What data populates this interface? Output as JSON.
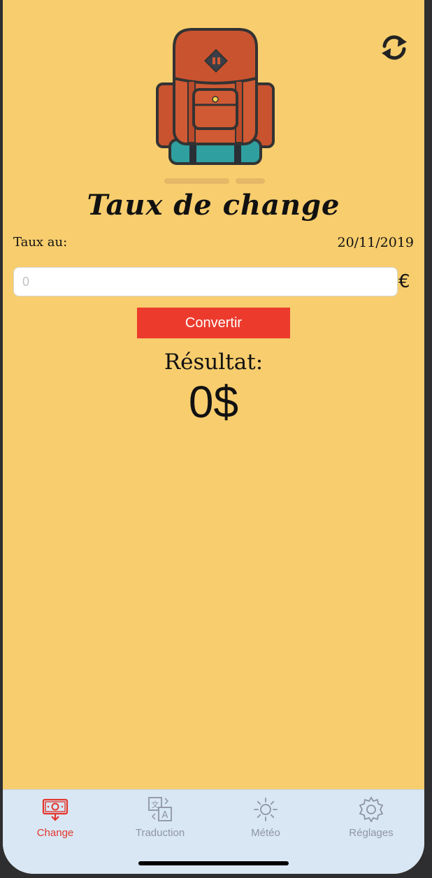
{
  "header": {
    "refresh_icon": "refresh-icon",
    "backpack_icon": "backpack-icon",
    "page_indicator": {
      "pages": 2,
      "current": 1
    }
  },
  "main": {
    "title": "Taux de change",
    "rate_label": "Taux au:",
    "rate_date": "20/11/2019",
    "amount_placeholder": "0",
    "amount_value": "",
    "currency_symbol": "€",
    "convert_label": "Convertir",
    "result_label": "Résultat:",
    "result_value": "0$"
  },
  "tabbar": {
    "items": [
      {
        "label": "Change",
        "icon": "money-icon",
        "active": true
      },
      {
        "label": "Traduction",
        "icon": "translate-icon",
        "active": false
      },
      {
        "label": "Météo",
        "icon": "sun-icon",
        "active": false
      },
      {
        "label": "Réglages",
        "icon": "gear-icon",
        "active": false
      }
    ]
  },
  "colors": {
    "background": "#f7cd6e",
    "accent": "#ec3b2d",
    "tabbar_background": "#d9e7f5",
    "tab_inactive": "#8e95a0",
    "tab_active": "#e3352b"
  }
}
